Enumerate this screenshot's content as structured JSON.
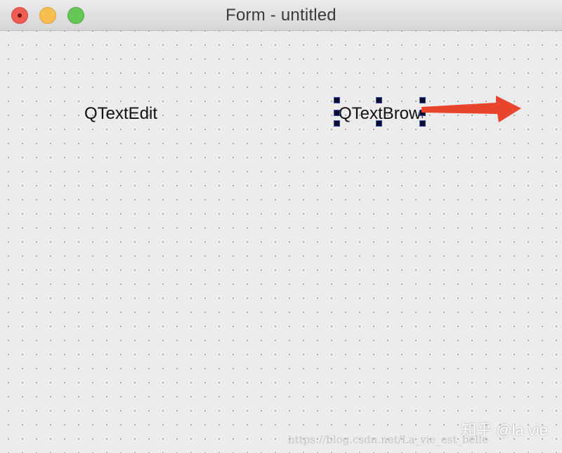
{
  "window": {
    "title": "Form - untitled",
    "buttons": {
      "close": "#ee5d55",
      "minimize": "#f5be4f",
      "zoom": "#63c655"
    }
  },
  "form": {
    "widgets": [
      {
        "label": "QTextEdit"
      },
      {
        "label": "QTextBrowser",
        "selected": true
      }
    ],
    "arrow_color": "#e8452c",
    "selection_handle_color": "#0a0a2a"
  },
  "watermark": {
    "zhihu": "知乎 @la vie",
    "url": "https://blog.csdn.net/La_vie_est_belle"
  }
}
